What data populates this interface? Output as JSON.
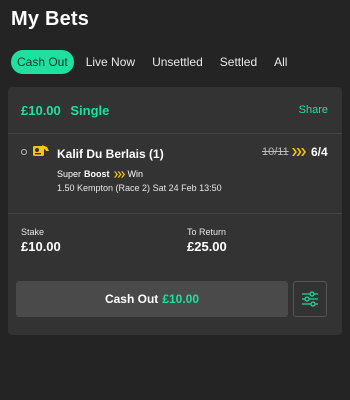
{
  "header": {
    "title": "My Bets"
  },
  "tabs": [
    {
      "label": "Cash Out",
      "active": true
    },
    {
      "label": "Live Now",
      "active": false
    },
    {
      "label": "Unsettled",
      "active": false
    },
    {
      "label": "Settled",
      "active": false
    },
    {
      "label": "All",
      "active": false
    }
  ],
  "bet": {
    "amount": "£10.00",
    "type": "Single",
    "share_label": "Share",
    "selection": "Kalif Du Berlais (1)",
    "old_odds": "10/11",
    "new_odds": "6/4",
    "boost_prefix": "Super",
    "boost_word": "Boost",
    "market": "Win",
    "race": "1.50 Kempton (Race 2)",
    "race_time": "Sat 24 Feb 13:50",
    "stake_label": "Stake",
    "stake_value": "£10.00",
    "return_label": "To Return",
    "return_value": "£25.00",
    "cashout_label": "Cash Out",
    "cashout_amount": "£10.00"
  },
  "colors": {
    "accent": "#1fe09e",
    "boost_chevron": "#f5c518",
    "background": "#242424",
    "card": "#333333"
  },
  "icons": {
    "selection_icon": "horse-racing-icon",
    "boost_icon": "triple-chevron-icon",
    "settings_icon": "sliders-icon"
  }
}
